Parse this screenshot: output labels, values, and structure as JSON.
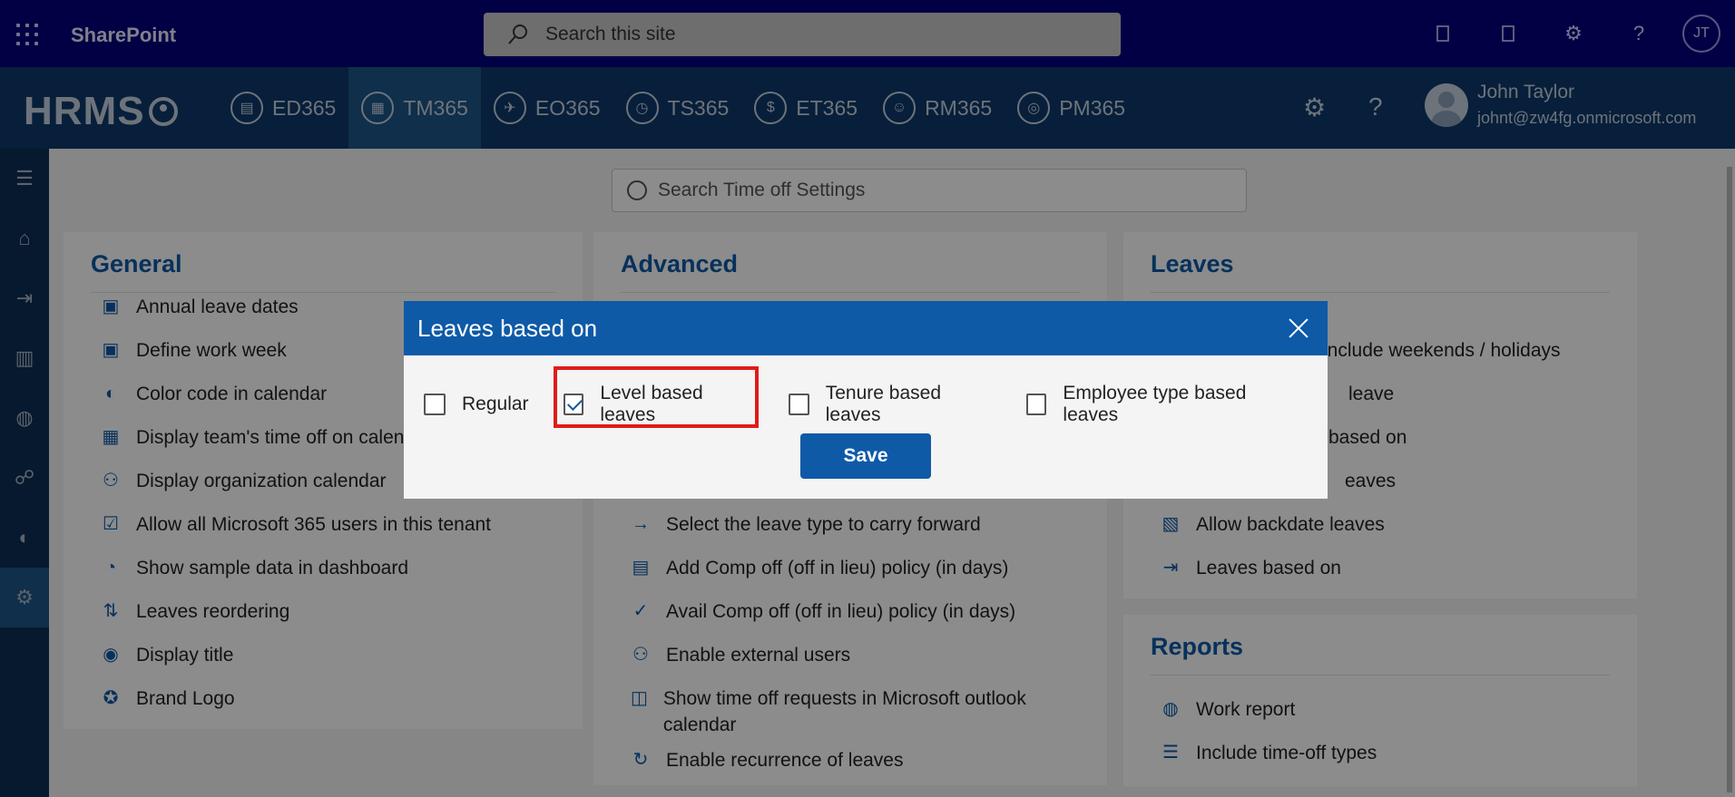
{
  "topbar": {
    "app_name": "SharePoint",
    "search_placeholder": "Search this site",
    "avatar_initials": "JT"
  },
  "nav": {
    "logo": "HRMS",
    "tabs": [
      {
        "label": "ED365",
        "icon": "id-badge-icon"
      },
      {
        "label": "TM365",
        "icon": "calendar-icon",
        "active": true
      },
      {
        "label": "EO365",
        "icon": "onboarding-icon"
      },
      {
        "label": "TS365",
        "icon": "clock-icon"
      },
      {
        "label": "ET365",
        "icon": "expense-icon"
      },
      {
        "label": "RM365",
        "icon": "person-icon"
      },
      {
        "label": "PM365",
        "icon": "performance-icon"
      }
    ],
    "user": {
      "name": "John Taylor",
      "email": "johnt@zw4fg.onmicrosoft.com"
    }
  },
  "settings_search_placeholder": "Search Time off Settings",
  "general": {
    "title": "General",
    "items": [
      "Annual leave dates",
      "Define work week",
      "Color code in calendar",
      "Display team's time off on calend",
      "Display organization calendar",
      "Allow all Microsoft 365 users in this tenant",
      "Show sample data in dashboard",
      "Leaves reordering",
      "Display title",
      "Brand Logo"
    ]
  },
  "advanced": {
    "title": "Advanced",
    "items": [
      "Select the leave type to carry forward",
      "Add Comp off (off in lieu) policy (in days)",
      "Avail Comp off (off in lieu) policy (in days)",
      "Enable external users",
      "Show time off requests in Microsoft outlook calendar",
      "Enable recurrence of leaves"
    ]
  },
  "leaves": {
    "title": "Leaves",
    "items": [
      "include weekends / holidays",
      "leave",
      "based on",
      "eaves",
      "Allow backdate leaves",
      "Leaves based on"
    ]
  },
  "reports": {
    "title": "Reports",
    "items": [
      "Work report",
      "Include time-off types"
    ]
  },
  "modal": {
    "title": "Leaves based on",
    "options": [
      {
        "label": "Regular",
        "checked": false
      },
      {
        "label": "Level based leaves",
        "checked": true
      },
      {
        "label": "Tenure based leaves",
        "checked": false
      },
      {
        "label": "Employee type based leaves",
        "checked": false
      }
    ],
    "save_label": "Save",
    "highlight_color": "#e01b1b"
  },
  "colors": {
    "sp_bar": "#02007c",
    "nav_bar": "#0e3a6b",
    "accent": "#0e5aa7"
  }
}
